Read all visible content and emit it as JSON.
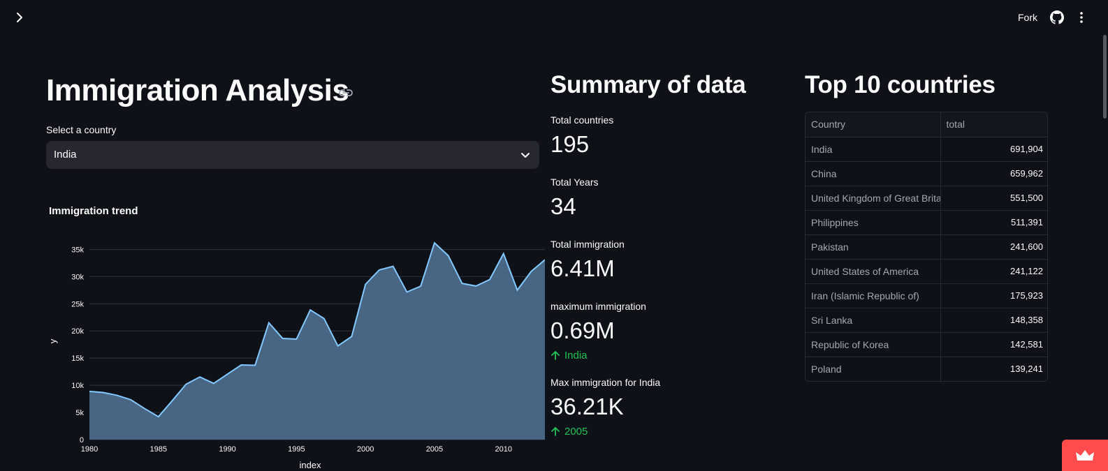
{
  "header": {
    "fork_label": "Fork"
  },
  "title": "Immigration Analysis",
  "select": {
    "label": "Select a country",
    "value": "India"
  },
  "chart_title": "Immigration trend",
  "chart_data": {
    "type": "area",
    "x": [
      1980,
      1981,
      1982,
      1983,
      1984,
      1985,
      1986,
      1987,
      1988,
      1989,
      1990,
      1991,
      1992,
      1993,
      1994,
      1995,
      1996,
      1997,
      1998,
      1999,
      2000,
      2001,
      2002,
      2003,
      2004,
      2005,
      2006,
      2007,
      2008,
      2009,
      2010,
      2011,
      2012,
      2013
    ],
    "y": [
      8880,
      8670,
      8147,
      7338,
      5704,
      4211,
      7150,
      10189,
      11522,
      10343,
      12041,
      13734,
      13673,
      21496,
      18620,
      18489,
      23859,
      22268,
      17241,
      18974,
      28572,
      31223,
      31889,
      27155,
      28235,
      36210,
      33848,
      28742,
      28261,
      29456,
      34235,
      27509,
      30933,
      33087
    ],
    "xlabel": "index",
    "ylabel": "y",
    "ylim": [
      0,
      36210
    ],
    "xticks": [
      1980,
      1985,
      1990,
      1995,
      2000,
      2005,
      2010
    ],
    "yticks": [
      0,
      5000,
      10000,
      15000,
      20000,
      25000,
      30000,
      35000
    ],
    "ytick_labels": [
      "0",
      "5k",
      "10k",
      "15k",
      "20k",
      "25k",
      "30k",
      "35k"
    ],
    "grid": true,
    "fill_color": "#4c6b8a",
    "line_color": "#83c9ff"
  },
  "summary": {
    "title": "Summary of data",
    "metrics": [
      {
        "label": "Total countries",
        "value": "195"
      },
      {
        "label": "Total Years",
        "value": "34"
      },
      {
        "label": "Total immigration",
        "value": "6.41M"
      },
      {
        "label": "maximum immigration",
        "value": "0.69M",
        "delta": "India"
      },
      {
        "label": "Max immigration for India",
        "value": "36.21K",
        "delta": "2005"
      }
    ]
  },
  "top": {
    "title": "Top 10 countries",
    "columns": [
      "Country",
      "total"
    ],
    "rows": [
      [
        "India",
        "691,904"
      ],
      [
        "China",
        "659,962"
      ],
      [
        "United Kingdom of Great Britain",
        "551,500"
      ],
      [
        "Philippines",
        "511,391"
      ],
      [
        "Pakistan",
        "241,600"
      ],
      [
        "United States of America",
        "241,122"
      ],
      [
        "Iran (Islamic Republic of)",
        "175,923"
      ],
      [
        "Sri Lanka",
        "148,358"
      ],
      [
        "Republic of Korea",
        "142,581"
      ],
      [
        "Poland",
        "139,241"
      ]
    ]
  },
  "colors": {
    "background": "#0e1117",
    "delta_positive": "#21c354",
    "badge": "#ff4b4b"
  }
}
